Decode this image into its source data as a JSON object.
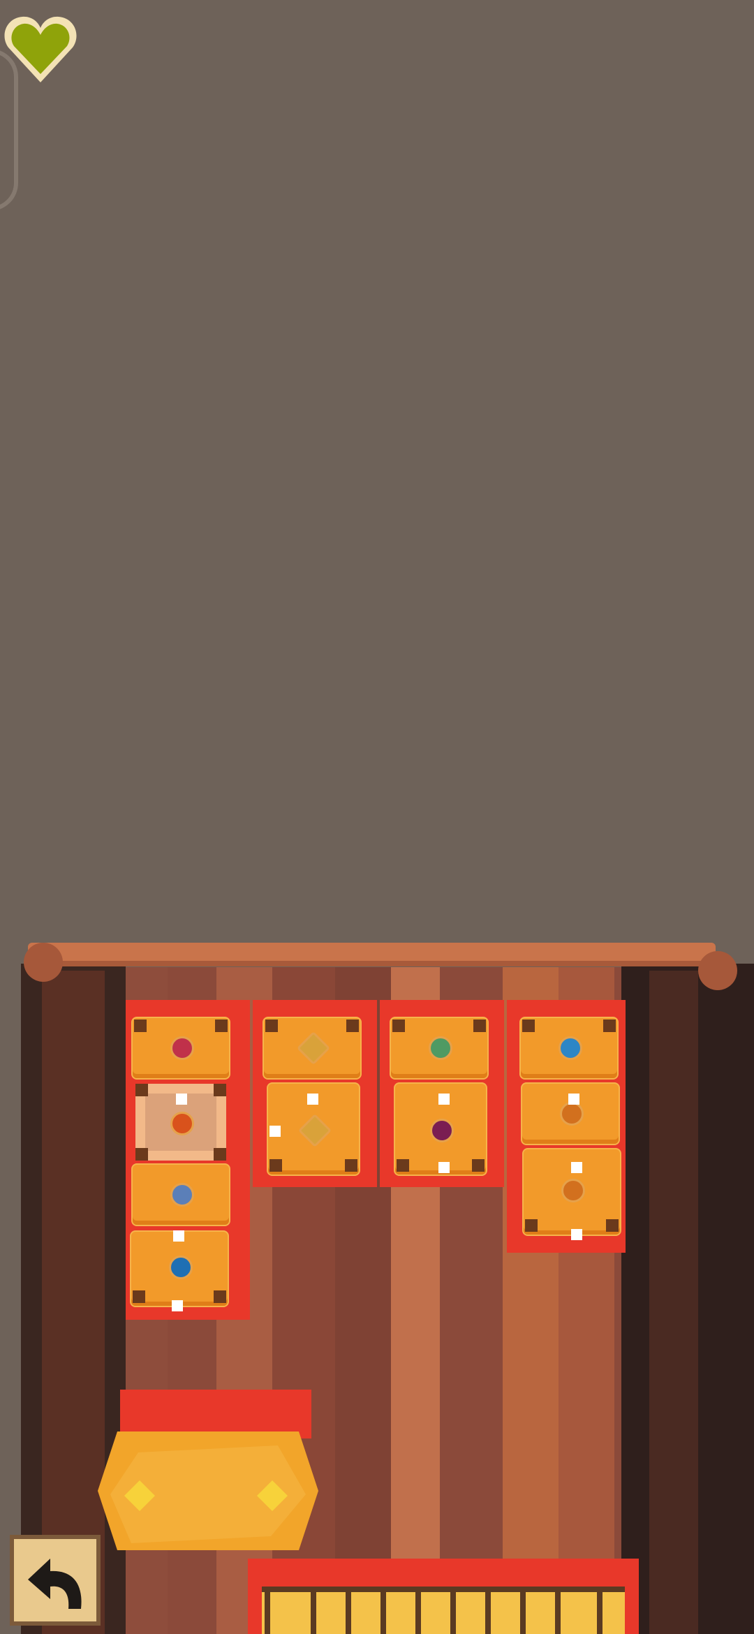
{
  "hud": {
    "lives_icon": "green-heart-icon",
    "lives_color": "#8fa30a"
  },
  "controls": {
    "undo_icon": "undo-arrow-icon"
  },
  "board": {
    "columns": [
      {
        "id": "col-1",
        "crates": [
          {
            "gem": "ruby-hex",
            "color": "#c0314a",
            "selected": false
          },
          {
            "gem": "fire-hex",
            "color": "#d9521c",
            "selected": true
          },
          {
            "gem": "blue-hex",
            "color": "#5b7fb8",
            "selected": false
          },
          {
            "gem": "deep-blue-hex",
            "color": "#1f6fb3",
            "selected": false
          }
        ]
      },
      {
        "id": "col-2",
        "crates": [
          {
            "gem": "amber-diamond",
            "color": "#d9a23a",
            "selected": false
          },
          {
            "gem": "amber-diamond",
            "color": "#d9a23a",
            "selected": false
          }
        ]
      },
      {
        "id": "col-3",
        "crates": [
          {
            "gem": "green-hex",
            "color": "#4f9a63",
            "selected": false
          },
          {
            "gem": "purple-hex",
            "color": "#7a1d52",
            "selected": false
          }
        ]
      },
      {
        "id": "col-4",
        "crates": [
          {
            "gem": "cyan-hex",
            "color": "#2d86c6",
            "selected": false
          },
          {
            "gem": "orange-oval",
            "color": "#d2701e",
            "selected": false
          },
          {
            "gem": "orange-oval",
            "color": "#d2701e",
            "selected": false
          }
        ]
      }
    ]
  }
}
